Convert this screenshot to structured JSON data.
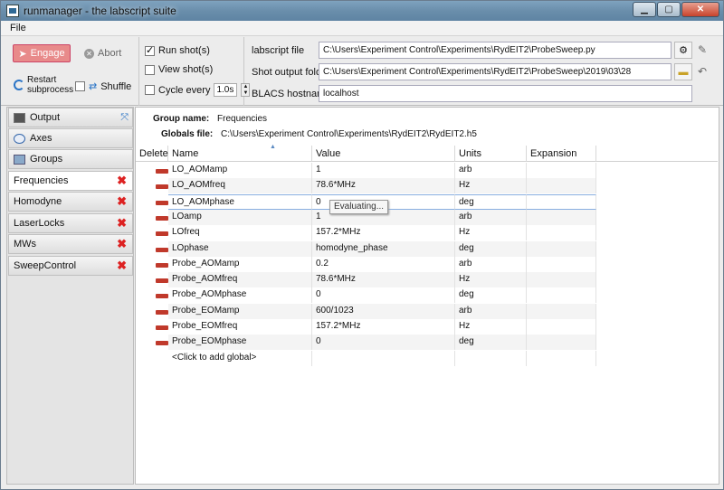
{
  "window": {
    "title": "runmanager - the labscript suite",
    "controls": {
      "minimize": "▁",
      "maximize": "▢",
      "close": "✕"
    }
  },
  "menu": {
    "file": "File"
  },
  "toolbar": {
    "engage": "Engage",
    "abort": "Abort",
    "restart": "Restart subprocess",
    "shuffle": "Shuffle",
    "shuffle_checked": false
  },
  "options": {
    "run_shots": {
      "label": "Run shot(s)",
      "checked": true
    },
    "view_shots": {
      "label": "View shot(s)",
      "checked": false
    },
    "cycle_every": {
      "label": "Cycle every",
      "checked": false,
      "value": "1.0s"
    }
  },
  "fields": {
    "labscript_file": {
      "label": "labscript file",
      "value": "C:\\Users\\Experiment Control\\Experiments\\RydEIT2\\ProbeSweep.py"
    },
    "shot_output_folder": {
      "label": "Shot output folder",
      "value": "C:\\Users\\Experiment Control\\Experiments\\RydEIT2\\ProbeSweep\\2019\\03\\28"
    },
    "blacs_hostname": {
      "label": "BLACS hostname",
      "value": "localhost"
    }
  },
  "left_tabs": [
    {
      "label": "Output",
      "icon": "terminal-icon"
    },
    {
      "label": "Axes",
      "icon": "axes-icon"
    },
    {
      "label": "Groups",
      "icon": "groups-icon"
    },
    {
      "label": "Frequencies",
      "closable": true,
      "active": true
    },
    {
      "label": "Homodyne",
      "closable": true
    },
    {
      "label": "LaserLocks",
      "closable": true
    },
    {
      "label": "MWs",
      "closable": true
    },
    {
      "label": "SweepControl",
      "closable": true
    }
  ],
  "group": {
    "name_label": "Group name:",
    "name": "Frequencies",
    "file_label": "Globals file:",
    "file": "C:\\Users\\Experiment Control\\Experiments\\RydEIT2\\RydEIT2.h5"
  },
  "table": {
    "columns": [
      "Delete",
      "Name",
      "Value",
      "Units",
      "Expansion"
    ],
    "rows": [
      {
        "name": "LO_AOMamp",
        "value": "1",
        "units": "arb"
      },
      {
        "name": "LO_AOMfreq",
        "value": "78.6*MHz",
        "units": "Hz"
      },
      {
        "name": "LO_AOMphase",
        "value": "0",
        "units": "deg"
      },
      {
        "name": "LOamp",
        "value": "1",
        "units": "arb"
      },
      {
        "name": "LOfreq",
        "value": "157.2*MHz",
        "units": "Hz"
      },
      {
        "name": "LOphase",
        "value": "homodyne_phase",
        "units": "deg"
      },
      {
        "name": "Probe_AOMamp",
        "value": "0.2",
        "units": "arb"
      },
      {
        "name": "Probe_AOMfreq",
        "value": "78.6*MHz",
        "units": "Hz"
      },
      {
        "name": "Probe_AOMphase",
        "value": "0",
        "units": "deg"
      },
      {
        "name": "Probe_EOMamp",
        "value": "600/1023",
        "units": "arb"
      },
      {
        "name": "Probe_EOMfreq",
        "value": "157.2*MHz",
        "units": "Hz"
      },
      {
        "name": "Probe_EOMphase",
        "value": "0",
        "units": "deg"
      }
    ],
    "add_row": "<Click to add global>",
    "tooltip": "Evaluating..."
  }
}
